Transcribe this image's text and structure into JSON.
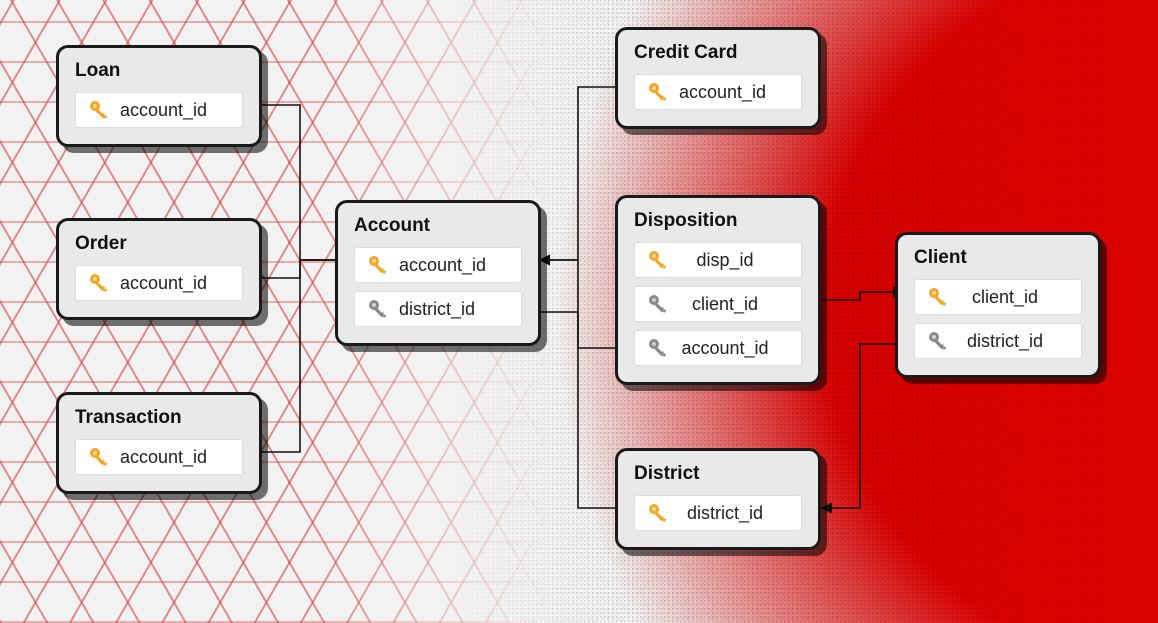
{
  "entities": {
    "loan": {
      "title": "Loan",
      "fields": [
        {
          "name": "account_id",
          "keyType": "primary"
        }
      ]
    },
    "order": {
      "title": "Order",
      "fields": [
        {
          "name": "account_id",
          "keyType": "primary"
        }
      ]
    },
    "transaction": {
      "title": "Transaction",
      "fields": [
        {
          "name": "account_id",
          "keyType": "primary"
        }
      ]
    },
    "account": {
      "title": "Account",
      "fields": [
        {
          "name": "account_id",
          "keyType": "primary"
        },
        {
          "name": "district_id",
          "keyType": "foreign"
        }
      ]
    },
    "creditCard": {
      "title": "Credit Card",
      "fields": [
        {
          "name": "account_id",
          "keyType": "primary"
        }
      ]
    },
    "disposition": {
      "title": "Disposition",
      "fields": [
        {
          "name": "disp_id",
          "keyType": "primary"
        },
        {
          "name": "client_id",
          "keyType": "foreign"
        },
        {
          "name": "account_id",
          "keyType": "foreign"
        }
      ]
    },
    "district": {
      "title": "District",
      "fields": [
        {
          "name": "district_id",
          "keyType": "primary"
        }
      ]
    },
    "client": {
      "title": "Client",
      "fields": [
        {
          "name": "client_id",
          "keyType": "primary"
        },
        {
          "name": "district_id",
          "keyType": "foreign"
        }
      ]
    }
  },
  "relationships": [
    {
      "from": "loan.account_id",
      "to": "account.account_id"
    },
    {
      "from": "order.account_id",
      "to": "account.account_id"
    },
    {
      "from": "transaction.account_id",
      "to": "account.account_id"
    },
    {
      "from": "creditCard.account_id",
      "to": "account.account_id"
    },
    {
      "from": "disposition.account_id",
      "to": "account.account_id"
    },
    {
      "from": "account.district_id",
      "to": "district.district_id"
    },
    {
      "from": "disposition.client_id",
      "to": "client.client_id"
    },
    {
      "from": "client.district_id",
      "to": "district.district_id"
    }
  ],
  "iconColors": {
    "primary": "#f5a623",
    "foreign": "#8a8a8a"
  }
}
